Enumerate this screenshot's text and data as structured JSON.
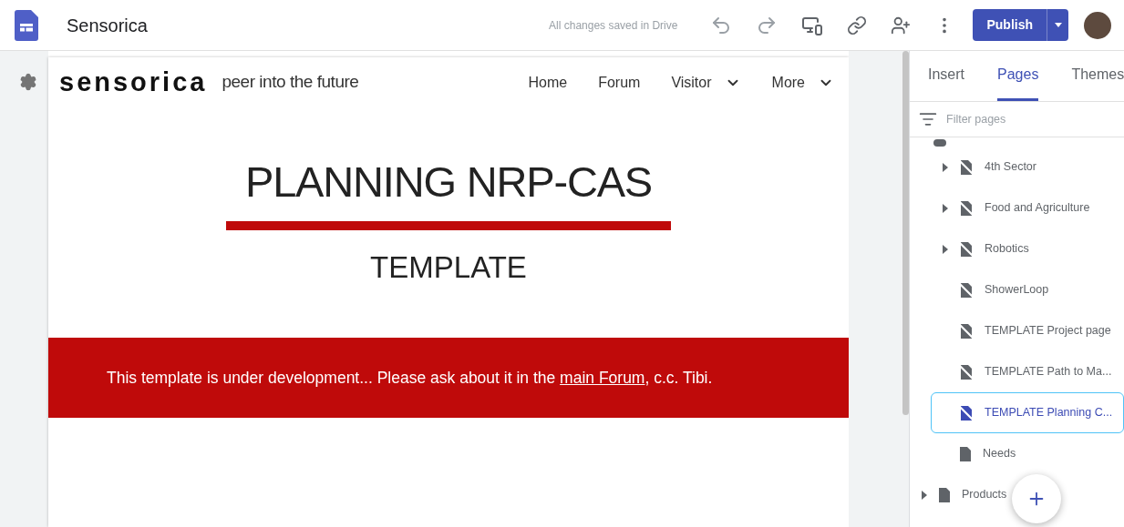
{
  "app": {
    "title": "Sensorica",
    "save_status": "All changes saved in Drive",
    "publish": "Publish"
  },
  "site": {
    "logo": "sensorica",
    "tagline": "peer into the future",
    "nav": [
      {
        "label": "Home",
        "dropdown": false
      },
      {
        "label": "Forum",
        "dropdown": false
      },
      {
        "label": "Visitor",
        "dropdown": true
      },
      {
        "label": "More",
        "dropdown": true
      }
    ],
    "title": "PLANNING NRP-CAS",
    "subtitle": "TEMPLATE",
    "banner": {
      "before": "This template is under development... Please ask about it in the ",
      "link": "main Forum",
      "after": ", c.c. Tibi."
    }
  },
  "panel": {
    "tabs": [
      {
        "label": "Insert",
        "selected": false
      },
      {
        "label": "Pages",
        "selected": true
      },
      {
        "label": "Themes",
        "selected": false
      }
    ],
    "filter": {
      "placeholder": "Filter pages"
    },
    "pages": [
      {
        "children": [
          {
            "label": "4th Sector",
            "kind": "hidden",
            "expandable": true,
            "selected": false
          },
          {
            "label": "Food and Agriculture",
            "kind": "hidden",
            "expandable": true,
            "selected": false
          },
          {
            "label": "Robotics",
            "kind": "hidden",
            "expandable": true,
            "selected": false
          },
          {
            "label": "ShowerLoop",
            "kind": "hidden",
            "expandable": false,
            "selected": false
          },
          {
            "label": "TEMPLATE Project page",
            "kind": "hidden",
            "expandable": false,
            "selected": false
          },
          {
            "label": "TEMPLATE Path to Ma...",
            "kind": "hidden",
            "expandable": false,
            "selected": false
          },
          {
            "label": "TEMPLATE Planning C...",
            "kind": "hidden",
            "expandable": false,
            "selected": true
          },
          {
            "label": "Needs",
            "kind": "page",
            "expandable": false,
            "selected": false
          }
        ]
      },
      {
        "label": "Products",
        "kind": "page",
        "expandable": true,
        "selected": false
      }
    ]
  }
}
